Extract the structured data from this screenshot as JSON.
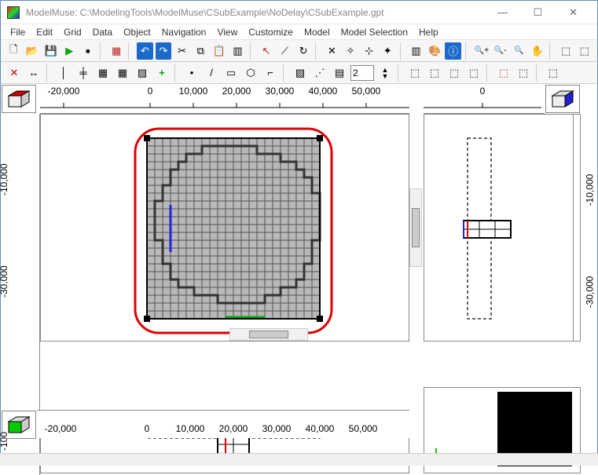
{
  "window": {
    "title": "ModelMuse: C:\\ModelingTools\\ModelMuse\\CSubExample\\NoDelay\\CSubExample.gpt",
    "minimize": "—",
    "maximize": "☐",
    "close": "✕"
  },
  "menu": {
    "file": "File",
    "edit": "Edit",
    "grid": "Grid",
    "data": "Data",
    "object": "Object",
    "navigation": "Navigation",
    "view": "View",
    "customize": "Customize",
    "model": "Model",
    "model_selection": "Model Selection",
    "help": "Help"
  },
  "toolbar1": {
    "new": "🗋",
    "open": "📂",
    "save": "💾",
    "run": "▶",
    "stop": "■",
    "tile": "▦",
    "undo": "↶",
    "redo": "↷",
    "cut": "✂",
    "copy": "⧉",
    "paste": "📋",
    "delete": "▥",
    "pointer": "↖",
    "lasso": "⟋",
    "rotate": "↻",
    "snap1": "✕",
    "snap2": "✧",
    "snap3": "⊹",
    "snap4": "✦",
    "layers": "▥",
    "palette": "🎨",
    "info": "ⓘ",
    "zoom_in": "🔍+",
    "zoom_out": "🔍-",
    "zoom_fit": "🔍",
    "pan": "✋",
    "ex1": "⬚",
    "ex2": "⬚"
  },
  "toolbar2": {
    "del": "✕",
    "move": "↔",
    "line": "│",
    "grid1": "╪",
    "grid2": "▦",
    "grid3": "▦",
    "grid4": "▨",
    "plus": "+",
    "pt": "•",
    "seg": "/",
    "rect": "▭",
    "poly": "⬡",
    "step": "⌐",
    "hatch": "▨",
    "dots": "⋰",
    "stack": "▤",
    "spin_value": "2",
    "cube1": "⬚",
    "cube2": "⬚",
    "cube3": "⬚",
    "cube4": "⬚",
    "cube5": "⬚",
    "cube6": "⬚",
    "cube7": "⬚"
  },
  "axes": {
    "top_ticks": [
      "-20,000",
      "0",
      "10,000",
      "20,000",
      "30,000",
      "40,000",
      "50,000"
    ],
    "top_right_tick": "0",
    "left_ticks": [
      "-10,000",
      "-30,000"
    ],
    "left_bottom_tick": "-100",
    "bottom_ticks": [
      "-20,000",
      "0",
      "10,000",
      "20,000",
      "30,000",
      "40,000",
      "50,000"
    ]
  },
  "chart_data": {
    "type": "grid-model",
    "views": [
      {
        "name": "top-view",
        "x_range": [
          -30000,
          55000
        ],
        "y_range": [
          -40000,
          5000
        ],
        "model_extent": {
          "x": [
            -2000,
            42000
          ],
          "y": [
            -38000,
            2000
          ]
        },
        "active_cells_shape": "roughly-circular stepped outline grid",
        "grid_cell_size_approx": 2000,
        "highlights": {
          "left_edge_column": "blue",
          "bottom_edge_row": "green",
          "selection_rectangle": {
            "color": "red",
            "covers": "full model extent",
            "handles": 4
          }
        }
      },
      {
        "name": "front-view",
        "x_range": [
          -30000,
          55000
        ],
        "z_range": [
          -150,
          0
        ],
        "layers": 3,
        "highlight_col": "red"
      },
      {
        "name": "side-view",
        "y_range": [
          -40000,
          5000
        ],
        "z_range": [
          -150,
          0
        ],
        "layers": 3,
        "highlight_col": "red",
        "blue_col": true
      },
      {
        "name": "3d-view",
        "render": "black-filled-box"
      }
    ]
  }
}
